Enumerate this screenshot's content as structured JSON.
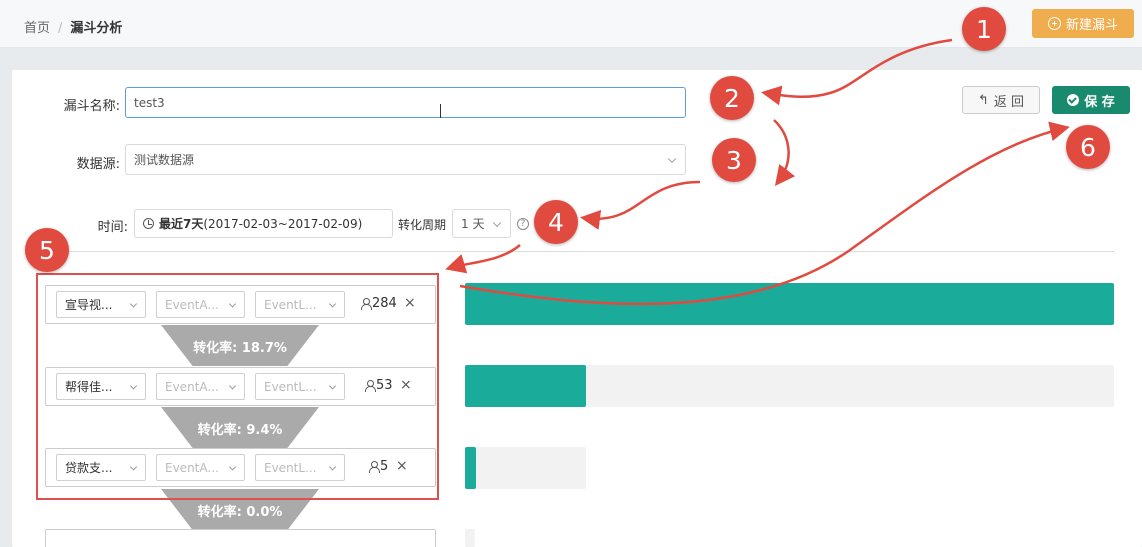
{
  "breadcrumb": {
    "home": "首页",
    "separator": "/",
    "current": "漏斗分析"
  },
  "header": {
    "new_funnel_label": "新建漏斗",
    "new_funnel_icon": "plus-circle-icon"
  },
  "form": {
    "name_label": "漏斗名称:",
    "name_value": "test3",
    "datasource_label": "数据源:",
    "datasource_value": "测试数据源",
    "time_label": "时间:",
    "time_prefix": "最近7天",
    "time_range": "(2017-02-03~2017-02-09)",
    "period_label": "转化周期",
    "period_value": "1 天",
    "help_icon": "question-circle-icon",
    "help_glyph": "?"
  },
  "actions": {
    "back_label": "返 回",
    "back_icon": "undo-arrow-icon",
    "back_glyph": "↰",
    "save_label": "保 存",
    "save_icon": "check-circle-icon"
  },
  "steps": [
    {
      "event": "宣导视...",
      "attr1": "EventA...",
      "attr2": "EventL...",
      "count": "284",
      "remove": "×"
    },
    {
      "event": "帮得佳...",
      "attr1": "EventA...",
      "attr2": "EventL...",
      "count": "53",
      "remove": "×"
    },
    {
      "event": "贷款支...",
      "attr1": "EventA...",
      "attr2": "EventL...",
      "count": "5",
      "remove": "×"
    }
  ],
  "conversions": [
    "转化率: 18.7%",
    "转化率: 9.4%",
    "转化率: 0.0%"
  ],
  "chart_data": {
    "type": "bar",
    "orientation": "horizontal",
    "categories": [
      "宣导视...",
      "帮得佳...",
      "贷款支..."
    ],
    "values": [
      284,
      53,
      5
    ],
    "conversion_rates_percent": [
      18.7,
      9.4,
      0.0
    ],
    "bar_color": "#1aab9b",
    "track_color": "#f2f2f2"
  },
  "annotations": {
    "badges": [
      "1",
      "2",
      "3",
      "4",
      "5",
      "6"
    ],
    "color": "#e04a3f"
  },
  "colors": {
    "accent_orange": "#f0ad4e",
    "save_green": "#1a8a6e",
    "bar_teal": "#1aab9b",
    "annotation_red": "#e04a3f"
  }
}
